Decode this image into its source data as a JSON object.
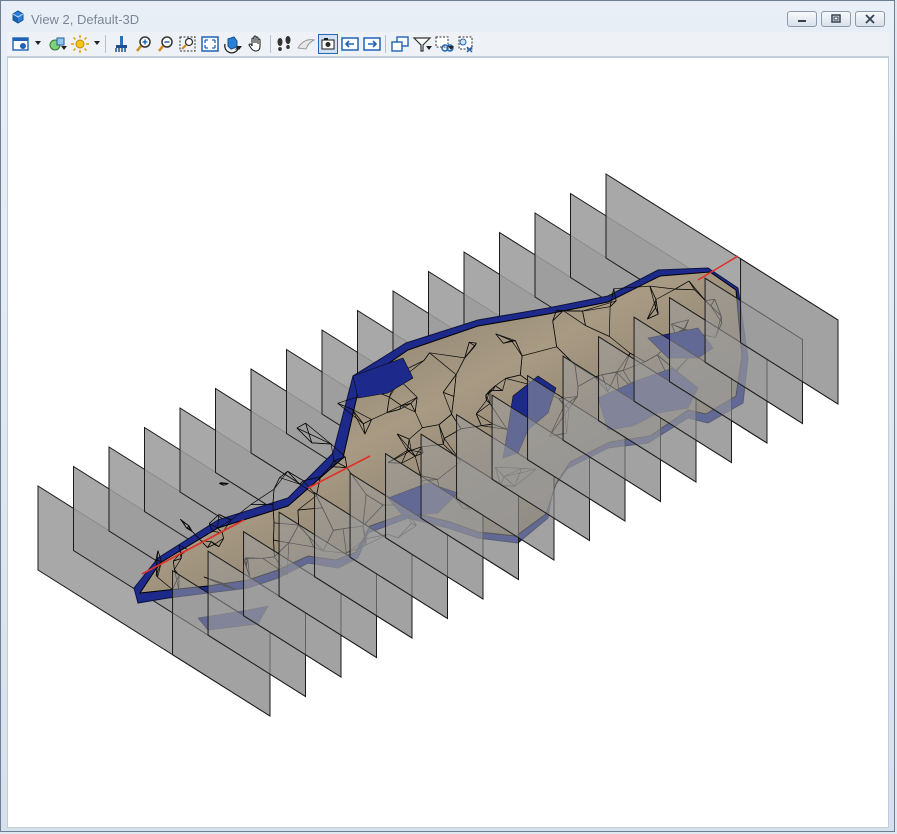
{
  "window": {
    "title": "View 2, Default-3D",
    "icon": "view-cube-icon",
    "controls": {
      "minimize": "minimize-icon",
      "restore": "restore-icon",
      "close": "close-icon"
    }
  },
  "toolbar": {
    "buttons": [
      {
        "name": "view-attributes",
        "icon": "view-attributes-icon",
        "has_dropdown": true
      },
      {
        "name": "display-style",
        "icon": "display-style-icon",
        "has_dropdown": false
      },
      {
        "name": "lighting",
        "icon": "sun-icon",
        "has_dropdown": true
      },
      {
        "name": "update-view",
        "icon": "brush-icon"
      },
      {
        "name": "zoom-in",
        "icon": "zoom-in-icon"
      },
      {
        "name": "zoom-out",
        "icon": "zoom-out-icon"
      },
      {
        "name": "window-area",
        "icon": "window-area-icon"
      },
      {
        "name": "fit-view",
        "icon": "fit-view-icon"
      },
      {
        "name": "rotate-view",
        "icon": "rotate-view-icon"
      },
      {
        "name": "pan-view",
        "icon": "hand-icon"
      },
      {
        "name": "walk",
        "icon": "footprints-icon"
      },
      {
        "name": "fly",
        "icon": "fly-icon"
      },
      {
        "name": "camera",
        "icon": "camera-icon",
        "active": true
      },
      {
        "name": "view-previous",
        "icon": "arrow-left-icon"
      },
      {
        "name": "view-next",
        "icon": "arrow-right-icon"
      },
      {
        "name": "copy-view",
        "icon": "copy-view-icon"
      },
      {
        "name": "view-clip",
        "icon": "clip-volume-icon"
      },
      {
        "name": "clip-mask",
        "icon": "clip-mask-icon"
      },
      {
        "name": "clear-clip",
        "icon": "clear-clip-icon"
      }
    ]
  },
  "colors": {
    "section_plane_fill": "#9c9c9c",
    "section_plane_stroke": "#1a1a1a",
    "mesh_fill": "#8a7e6c",
    "mesh_underside": "#1d2a8c",
    "mesh_edges": "#000000",
    "alignment_line": "#e0302a",
    "viewport_background": "#ffffff"
  },
  "scene": {
    "section_plane_count": 17,
    "model": "terrain-mesh",
    "alignment_line": "red-centerline"
  }
}
